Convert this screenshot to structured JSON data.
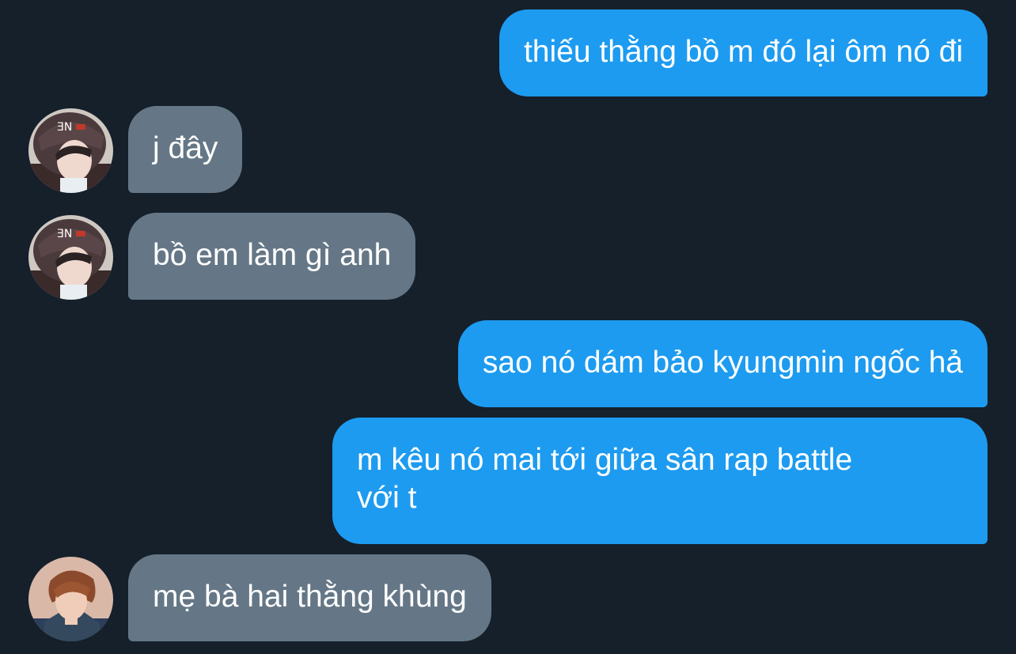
{
  "conversation": {
    "messages": [
      {
        "side": "sent",
        "text": "thiếu thằng bồ m đó lại ôm nó đi"
      },
      {
        "side": "received",
        "avatar": "avatar-beanie",
        "text": "j đây"
      },
      {
        "side": "received",
        "avatar": "avatar-beanie",
        "text": "bồ em làm gì anh"
      },
      {
        "side": "sent",
        "text": "sao nó dám bảo kyungmin ngốc hả"
      },
      {
        "side": "sent",
        "lines": [
          "m kêu nó mai tới giữa sân rap battle",
          "với t"
        ]
      },
      {
        "side": "received",
        "avatar": "avatar-redhair",
        "text": "mẹ bà hai thằng khùng"
      }
    ]
  },
  "colors": {
    "background": "#15202b",
    "sent_bubble": "#1d9bf0",
    "received_bubble": "#657786",
    "text": "#ffffff"
  }
}
